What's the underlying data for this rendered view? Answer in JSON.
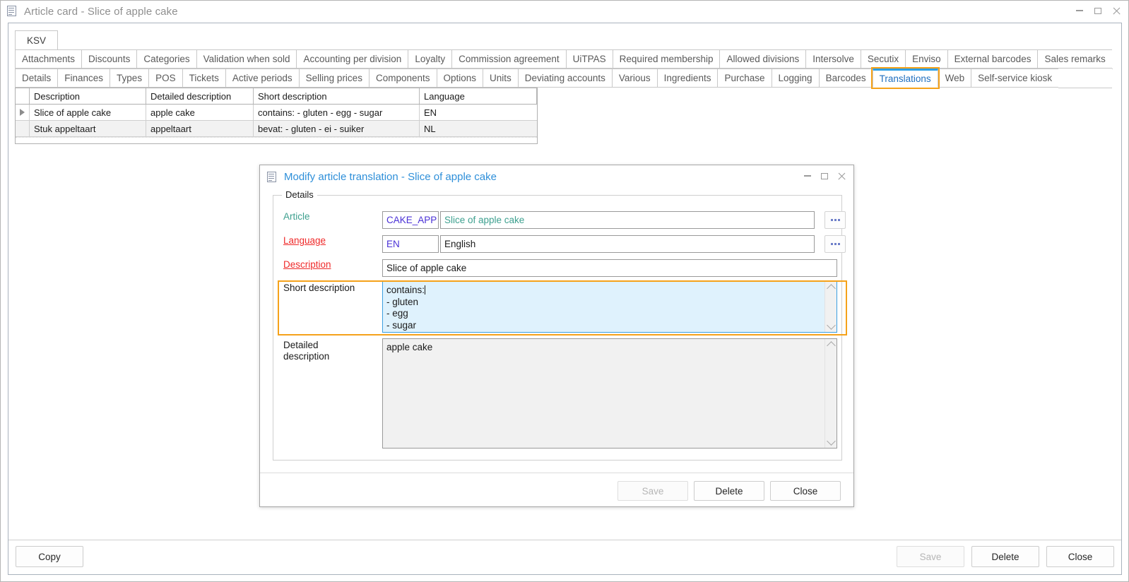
{
  "window": {
    "title": "Article card - Slice of apple cake",
    "icon": "document-icon",
    "controls": {
      "minimize": "–",
      "maximize": "□",
      "close": "✕"
    }
  },
  "ksv_tab": {
    "label": "KSV"
  },
  "tabs_row1": [
    "Attachments",
    "Discounts",
    "Categories",
    "Validation when sold",
    "Accounting per division",
    "Loyalty",
    "Commission agreement",
    "UiTPAS",
    "Required membership",
    "Allowed divisions",
    "Intersolve",
    "Secutix",
    "Enviso",
    "External barcodes",
    "Sales remarks"
  ],
  "tabs_row2": [
    "Details",
    "Finances",
    "Types",
    "POS",
    "Tickets",
    "Active periods",
    "Selling prices",
    "Components",
    "Options",
    "Units",
    "Deviating accounts",
    "Various",
    "Ingredients",
    "Purchase",
    "Logging",
    "Barcodes",
    "Translations",
    "Web",
    "Self-service kiosk"
  ],
  "active_tab": "Translations",
  "grid": {
    "columns": [
      "Description",
      "Detailed description",
      "Short description",
      "Language"
    ],
    "rows": [
      {
        "selected": true,
        "description": "Slice of apple cake",
        "detailed_description": "apple cake",
        "short_description": "contains: - gluten - egg - sugar",
        "language": "EN"
      },
      {
        "selected": false,
        "description": "Stuk appeltaart",
        "detailed_description": "appeltaart",
        "short_description": "bevat: - gluten - ei - suiker",
        "language": "NL"
      }
    ]
  },
  "footer": {
    "copy_label": "Copy",
    "save_label": "Save",
    "delete_label": "Delete",
    "close_label": "Close",
    "save_disabled": true
  },
  "dialog": {
    "title": "Modify article translation - Slice of apple cake",
    "icon": "document-icon",
    "groupbox_legend": "Details",
    "fields": {
      "article": {
        "label": "Article",
        "label_style": "teal",
        "code": "CAKE_APP",
        "name": "Slice of apple cake",
        "browse_label": "..."
      },
      "language": {
        "label": "Language",
        "label_style": "required",
        "code": "EN",
        "name": "English",
        "browse_label": "..."
      },
      "description": {
        "label": "Description",
        "label_style": "required",
        "value": "Slice of apple cake"
      },
      "short_description": {
        "label": "Short description",
        "label_style": "plain",
        "value": "contains:\n- gluten\n- egg\n- sugar",
        "focused": true,
        "highlighted": true
      },
      "detailed_description": {
        "label": "Detailed\ndescription",
        "label_style": "plain",
        "value": "apple cake",
        "focused": false
      }
    },
    "buttons": {
      "save_label": "Save",
      "delete_label": "Delete",
      "close_label": "Close",
      "save_disabled": true
    },
    "controls": {
      "minimize": "–",
      "maximize": "□",
      "close": "✕"
    }
  },
  "colors": {
    "accent_blue": "#2e8fd9",
    "highlight_orange": "#f5a21a",
    "required_red": "#ef2a2a",
    "teal": "#3ea08f",
    "focus_bg": "#dff2fd"
  }
}
